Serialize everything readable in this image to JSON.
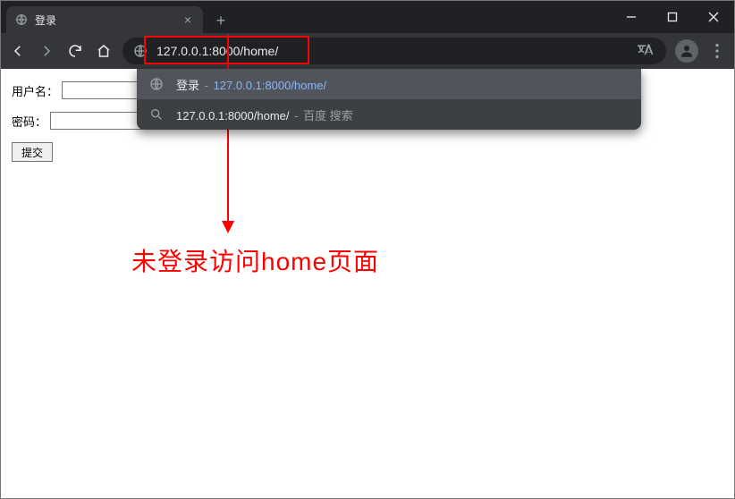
{
  "tab": {
    "title": "登录"
  },
  "url": "127.0.0.1:8000/home/",
  "suggestions": [
    {
      "prefix": "登录",
      "sep": " - ",
      "url": "127.0.0.1:8000/home/"
    },
    {
      "url": "127.0.0.1:8000/home/",
      "sep": " - ",
      "suffix": "百度 搜索"
    }
  ],
  "form": {
    "username_label": "用户名：",
    "password_label": "密码：",
    "submit": "提交"
  },
  "annotation": "未登录访问home页面"
}
